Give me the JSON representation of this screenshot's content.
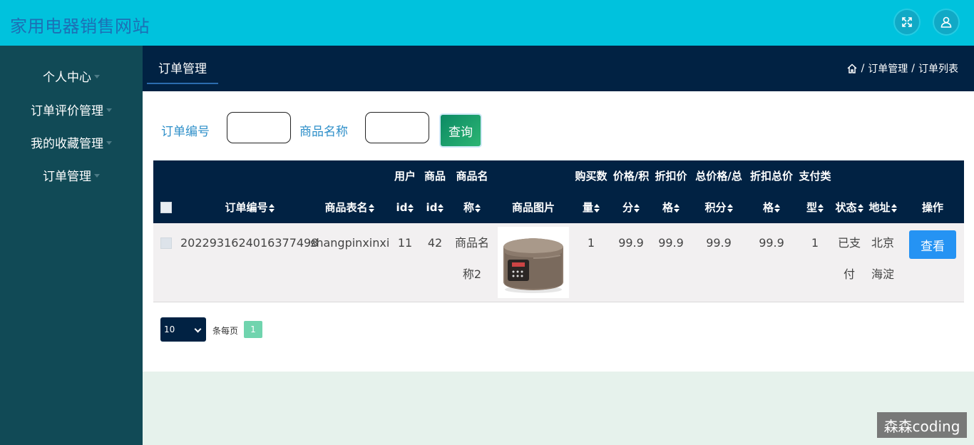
{
  "header": {
    "site_title": "家用电器销售网站",
    "icons": [
      "fullscreen-icon",
      "user-icon"
    ]
  },
  "sidebar": {
    "items": [
      {
        "label": "个人中心"
      },
      {
        "label": "订单评价管理"
      },
      {
        "label": "我的收藏管理"
      },
      {
        "label": "订单管理"
      }
    ]
  },
  "content_header": {
    "tab_label": "订单管理",
    "breadcrumb": [
      "订单管理",
      "订单列表"
    ],
    "sep": "/"
  },
  "search": {
    "order_no_label": "订单编号",
    "order_no_value": "",
    "product_name_label": "商品名称",
    "product_name_value": "",
    "query_button": "查询"
  },
  "table": {
    "headers": {
      "order_no": [
        "",
        "订单编号"
      ],
      "product_table": [
        "",
        "商品表名"
      ],
      "user_id": [
        "用户",
        "id"
      ],
      "product_id": [
        "商品",
        "id"
      ],
      "product_name": [
        "商品名",
        "称"
      ],
      "product_image": [
        "",
        "商品图片"
      ],
      "quantity": [
        "购买数",
        "量"
      ],
      "price": [
        "价格/积",
        "分"
      ],
      "discount_price": [
        "折扣价",
        "格"
      ],
      "total_price": [
        "总价格/总",
        "积分"
      ],
      "discount_total": [
        "折扣总价",
        "格"
      ],
      "pay_type": [
        "支付类",
        "型"
      ],
      "status": [
        "",
        "状态"
      ],
      "address": [
        "",
        "地址"
      ],
      "action": [
        "",
        "操作"
      ]
    },
    "rows": [
      {
        "order_no": "2022931624016377498",
        "product_table": "shangpinxinxi",
        "user_id": "11",
        "product_id": "42",
        "product_name": [
          "商品名",
          "称2"
        ],
        "image_icon": "rice-cooker-image",
        "quantity": "1",
        "price": "99.9",
        "discount_price": "99.9",
        "total_price": "99.9",
        "discount_total": "99.9",
        "pay_type": "1",
        "status": [
          "已支",
          "付"
        ],
        "address": [
          "北京",
          "海淀"
        ],
        "view_button": "查看"
      }
    ]
  },
  "pagination": {
    "page_size": "10",
    "per_page_label": "条每页",
    "current_page": "1"
  },
  "watermark": "森森coding"
}
